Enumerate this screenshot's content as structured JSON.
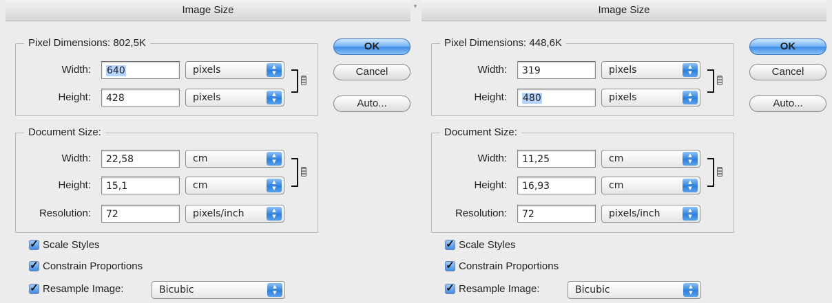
{
  "dialogs": [
    {
      "title": "Image Size",
      "pixel_dimensions": {
        "label": "Pixel Dimensions:",
        "size": "802,5K",
        "width": {
          "label": "Width:",
          "value": "640",
          "unit": "pixels"
        },
        "height": {
          "label": "Height:",
          "value": "428",
          "unit": "pixels"
        }
      },
      "buttons": {
        "ok": "OK",
        "cancel": "Cancel",
        "auto": "Auto..."
      },
      "document_size": {
        "label": "Document Size:",
        "width": {
          "label": "Width:",
          "value": "22,58",
          "unit": "cm"
        },
        "height": {
          "label": "Height:",
          "value": "15,1",
          "unit": "cm"
        },
        "resolution": {
          "label": "Resolution:",
          "value": "72",
          "unit": "pixels/inch"
        }
      },
      "options": {
        "scale_styles": {
          "label": "Scale Styles",
          "checked": true
        },
        "constrain_proportions": {
          "label": "Constrain Proportions",
          "checked": true
        },
        "resample_image": {
          "label": "Resample Image:",
          "checked": true,
          "method": "Bicubic"
        }
      }
    },
    {
      "title": "Image Size",
      "pixel_dimensions": {
        "label": "Pixel Dimensions:",
        "size": "448,6K",
        "width": {
          "label": "Width:",
          "value": "319",
          "unit": "pixels"
        },
        "height": {
          "label": "Height:",
          "value": "480",
          "unit": "pixels"
        }
      },
      "buttons": {
        "ok": "OK",
        "cancel": "Cancel",
        "auto": "Auto..."
      },
      "document_size": {
        "label": "Document Size:",
        "width": {
          "label": "Width:",
          "value": "11,25",
          "unit": "cm"
        },
        "height": {
          "label": "Height:",
          "value": "16,93",
          "unit": "cm"
        },
        "resolution": {
          "label": "Resolution:",
          "value": "72",
          "unit": "pixels/inch"
        }
      },
      "options": {
        "scale_styles": {
          "label": "Scale Styles",
          "checked": true
        },
        "constrain_proportions": {
          "label": "Constrain Proportions",
          "checked": true
        },
        "resample_image": {
          "label": "Resample Image:",
          "checked": true,
          "method": "Bicubic"
        }
      }
    }
  ],
  "colors": {
    "window_bg": "#ececec",
    "aqua_blue": "#3d8be6",
    "selection": "#b5d5ff"
  },
  "icons": {
    "popup_arrows": "up-down-arrows-icon",
    "chain_link": "chain-link-icon",
    "checkmark": "checkmark-icon"
  }
}
